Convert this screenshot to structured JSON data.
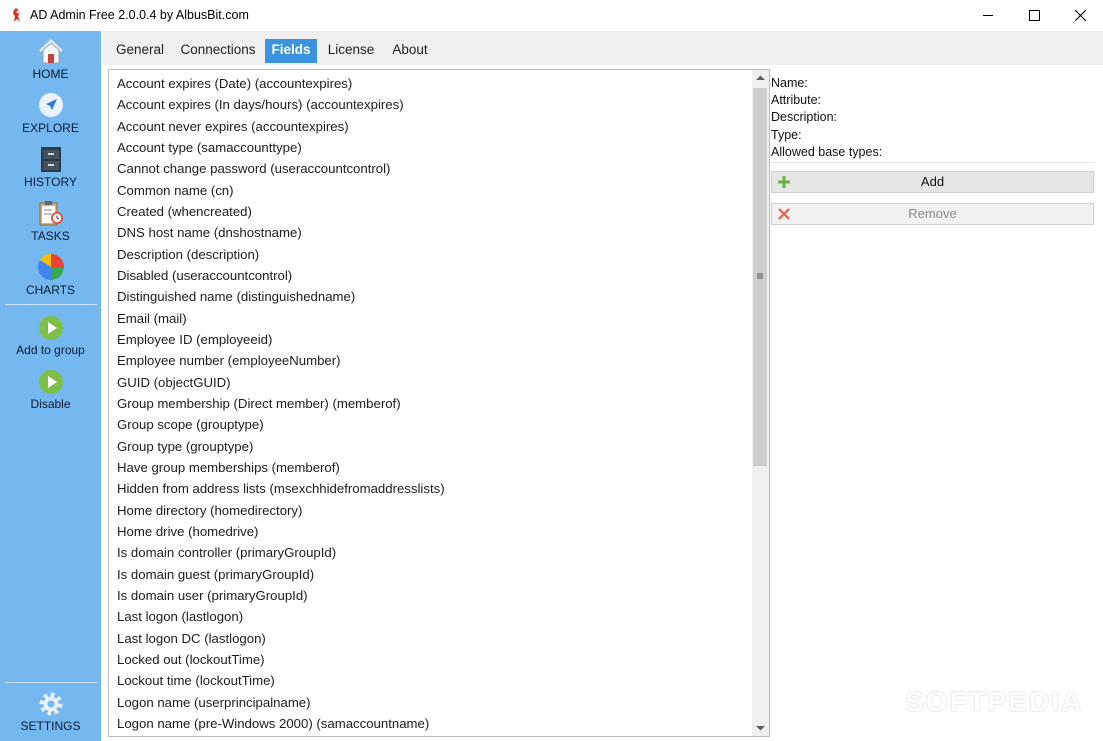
{
  "window": {
    "title": "AD Admin Free 2.0.0.4 by AlbusBit.com"
  },
  "sidebar": {
    "nav": [
      {
        "label": "HOME",
        "icon": "home-icon"
      },
      {
        "label": "EXPLORE",
        "icon": "navigation-arrow-icon"
      },
      {
        "label": "HISTORY",
        "icon": "file-cabinet-icon"
      },
      {
        "label": "TASKS",
        "icon": "clipboard-clock-icon"
      },
      {
        "label": "CHARTS",
        "icon": "pie-chart-icon"
      }
    ],
    "actions": [
      {
        "label": "Add to group",
        "icon": "play-icon"
      },
      {
        "label": "Disable",
        "icon": "play-icon"
      }
    ],
    "settings_label": "SETTINGS"
  },
  "tabs": [
    "General",
    "Connections",
    "Fields",
    "License",
    "About"
  ],
  "active_tab": "Fields",
  "fields": [
    "Account expires (Date) (accountexpires)",
    "Account expires (In days/hours) (accountexpires)",
    "Account never expires (accountexpires)",
    "Account type (samaccounttype)",
    "Cannot change password (useraccountcontrol)",
    "Common name (cn)",
    "Created (whencreated)",
    "DNS host name (dnshostname)",
    "Description (description)",
    "Disabled (useraccountcontrol)",
    "Distinguished name (distinguishedname)",
    "Email (mail)",
    "Employee ID (employeeid)",
    "Employee number (employeeNumber)",
    "GUID (objectGUID)",
    "Group membership (Direct member) (memberof)",
    "Group scope (grouptype)",
    "Group type (grouptype)",
    "Have group memberships (memberof)",
    "Hidden from address lists (msexchhidefromaddresslists)",
    "Home directory (homedirectory)",
    "Home drive (homedrive)",
    "Is domain controller (primaryGroupId)",
    "Is domain guest (primaryGroupId)",
    "Is domain user (primaryGroupId)",
    "Last logon (lastlogon)",
    "Last logon DC (lastlogon)",
    "Locked out (lockoutTime)",
    "Lockout time (lockoutTime)",
    "Logon name (userprincipalname)",
    "Logon name (pre-Windows 2000) (samaccountname)"
  ],
  "details": {
    "name_label": "Name:",
    "attribute_label": "Attribute:",
    "description_label": "Description:",
    "type_label": "Type:",
    "allowed_label": "Allowed base types:"
  },
  "buttons": {
    "add": "Add",
    "remove": "Remove"
  },
  "watermark": "SOFTPEDIA",
  "colors": {
    "sidebar": "#75b8f0",
    "active_tab": "#3a93de",
    "play": "#7cc047"
  }
}
